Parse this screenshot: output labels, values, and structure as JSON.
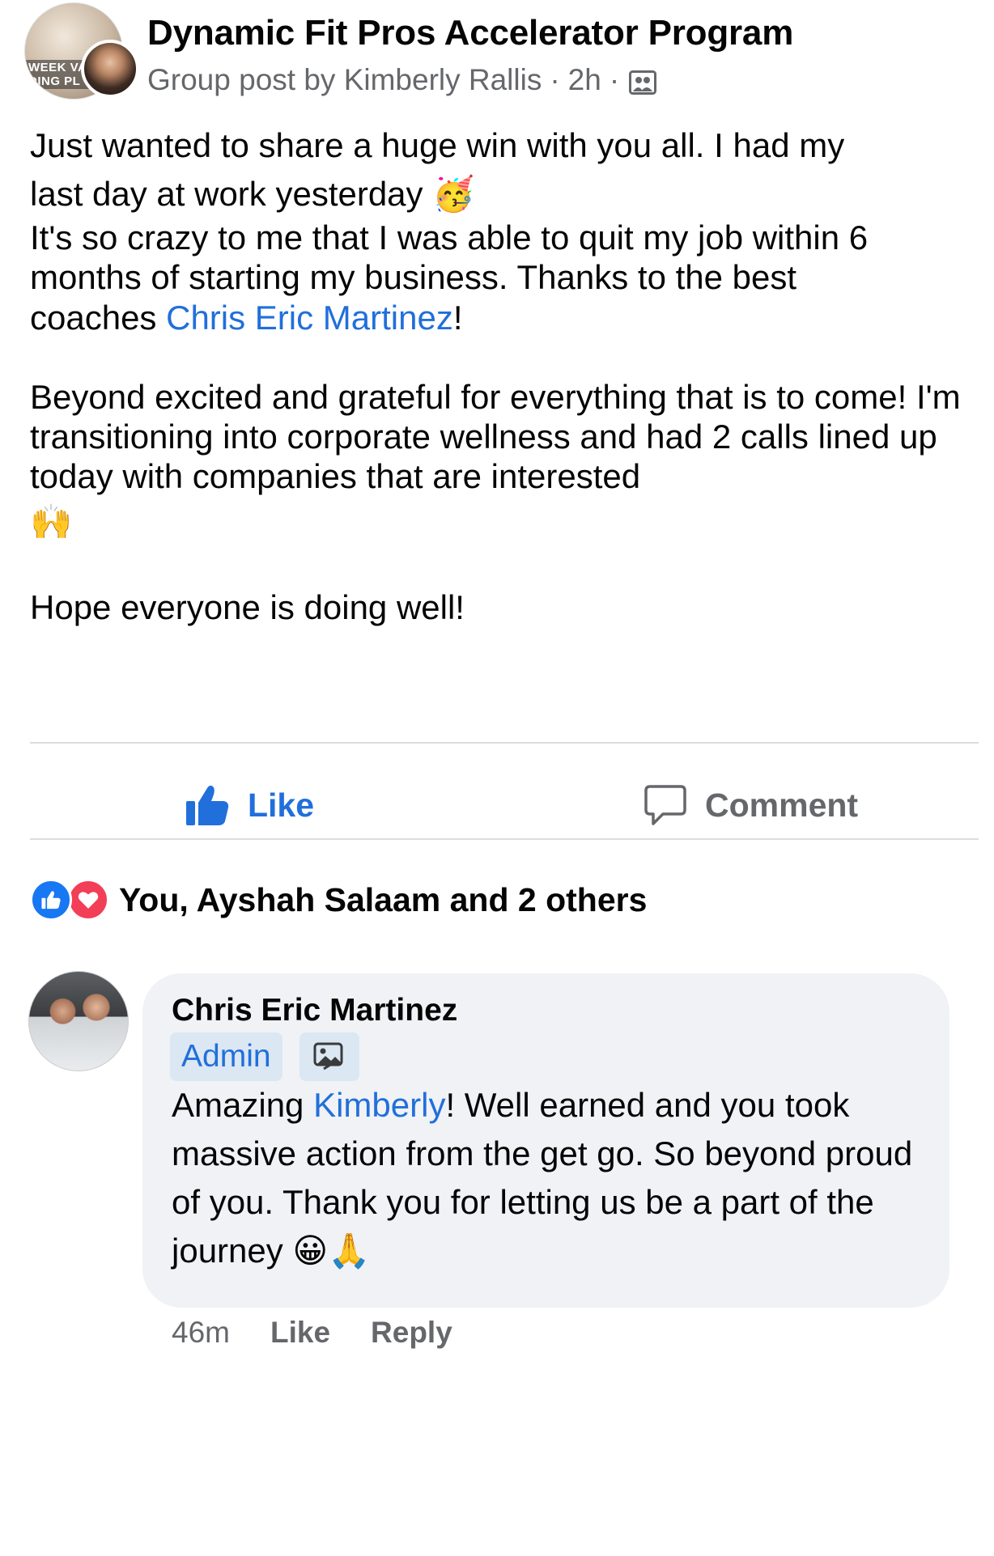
{
  "header": {
    "group_name": "Dynamic Fit Pros Accelerator Program",
    "group_avatar_text": "WEEK VA\nDING PL",
    "post_kind": "Group post by",
    "author": "Kimberly Rallis",
    "separator": "·",
    "time": "2h",
    "audience_icon": "group-icon"
  },
  "post": {
    "line1a": "Just wanted to share a huge win with you all. I had my",
    "line1b": "last day at work yesterday",
    "emoji_party": "🥳",
    "line2a": "It's so crazy to me that I was able to quit my job within 6",
    "line2b": "months of starting my business. Thanks to the best",
    "line2c_pre": "coaches ",
    "mention": "Chris Eric Martinez",
    "line2c_post": "!",
    "para2": "Beyond excited and grateful for everything that is to come! I'm transitioning into corporate wellness and had 2 calls lined up today with companies that are interested",
    "emoji_hands": "🙌",
    "para3": "Hope everyone is doing well!"
  },
  "actions": {
    "like_label": "Like",
    "comment_label": "Comment"
  },
  "reactions": {
    "summary": "You, Ayshah Salaam and 2 others",
    "types": [
      "like",
      "love"
    ]
  },
  "comment": {
    "author": "Chris Eric Martinez",
    "badge": "Admin",
    "text_pre": "Amazing ",
    "mention": "Kimberly",
    "text_post": "! Well earned and you took massive action from the get go. So beyond proud of you. Thank you for letting us be a part of the journey ",
    "emojis": "😀🙏",
    "time": "46m",
    "like_label": "Like",
    "reply_label": "Reply"
  },
  "colors": {
    "link_blue": "#216fdb",
    "secondary_text": "#65676b",
    "bubble_bg": "#f0f2f5",
    "like_blue": "#1877f2",
    "love_red": "#f33e58"
  }
}
